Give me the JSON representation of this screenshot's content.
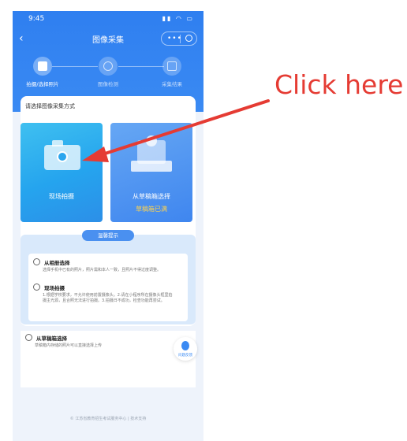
{
  "status_bar": {
    "time": "9:45",
    "icons": "▮▮ ◠ ▭"
  },
  "nav": {
    "back": "‹",
    "title": "图像采集",
    "more": "•••"
  },
  "steps": [
    {
      "label": "拍摄/选择照片",
      "active": true
    },
    {
      "label": "图像检测",
      "active": false
    },
    {
      "label": "采集结果",
      "active": false
    }
  ],
  "main": {
    "section_title": "请选择图像采集方式",
    "option_camera": {
      "label": "现场拍摄"
    },
    "option_draft": {
      "label": "从草稿箱选择",
      "sub": "草稿箱已满"
    }
  },
  "tips": {
    "tab": "温馨提示",
    "items": [
      {
        "title": "从相册选择",
        "text": "选择手机中已有的照片，照片需和本人一致，且照片不得过度调整。"
      },
      {
        "title": "现场拍摄",
        "text": "1.根据学校要求，不允许使用前置摄像头。2.请在小程序所在摄像头框里拍摄主光源，且合照无法进行拍摄。3.拍摄日不成功，检查功能再尝试。"
      },
      {
        "title": "从草稿箱选择",
        "text": "草稿箱内存储的照片可以直接选择上传"
      }
    ]
  },
  "float_button": {
    "label": "问题反馈"
  },
  "footer": "© 江苏省教育招生考试服务中心 | 技术支持",
  "annotation": {
    "text": "Click here",
    "color": "#e53b33"
  },
  "colors": {
    "primary": "#3a8af3",
    "warning": "#ffd34d",
    "annotation": "#e53b33"
  }
}
